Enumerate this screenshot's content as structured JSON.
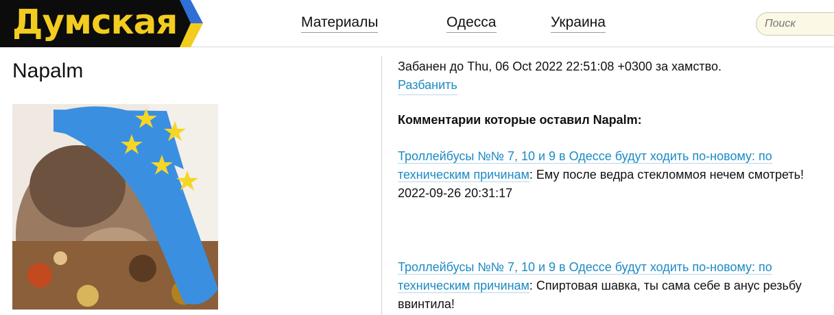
{
  "header": {
    "logo_text": "Думская",
    "nav": [
      {
        "label": "Материалы"
      },
      {
        "label": "Одесса"
      },
      {
        "label": "Украина"
      }
    ],
    "search": {
      "placeholder": "Поиск"
    },
    "colors": {
      "logo_bg": "#0c0c0c",
      "logo_text": "#f2cc1f",
      "logo_blue": "#2f6fd6",
      "logo_yellow": "#f2cc1f"
    }
  },
  "profile": {
    "username": "Napalm",
    "avatar_icon": "user-avatar-photo"
  },
  "ban": {
    "text": "Забанен до Thu, 06 Oct 2022 22:51:08 +0300 за хамство.",
    "unban_label": "Разбанить"
  },
  "comments_heading": "Комментарии которые оставил Napalm:",
  "comments": [
    {
      "article": "Троллейбусы №№ 7, 10 и 9 в Одессе будут ходить по-новому: по техническим причинам",
      "text": ": Ему после ведра стекломмоя нечем смотреть!",
      "date": "2022-09-26 20:31:17"
    },
    {
      "article": "Троллейбусы №№ 7, 10 и 9 в Одессе будут ходить по-новому: по техническим причинам",
      "text": ": Спиртовая шавка, ты сама себе в анус резьбу ввинтила!",
      "date": ""
    }
  ]
}
